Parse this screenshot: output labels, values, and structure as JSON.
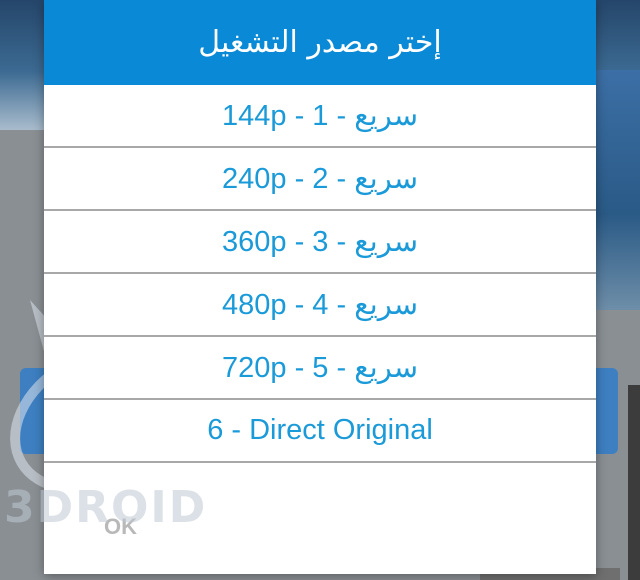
{
  "dialog": {
    "title": "إختر مصدر التشغيل",
    "options": [
      {
        "label": "سريع - 144p - 1"
      },
      {
        "label": "سريع - 240p - 2"
      },
      {
        "label": "سريع - 360p - 3"
      },
      {
        "label": "سريع - 480p - 4"
      },
      {
        "label": "سريع - 720p - 5"
      },
      {
        "label": "6 - Direct Original"
      }
    ],
    "ok_label": "OK"
  },
  "watermark": {
    "text": "3DROID"
  },
  "colors": {
    "header": "#0a8ad6",
    "option_text": "#1a9ad8",
    "divider": "#a8a8a8",
    "ok_text": "#b9b9b9"
  }
}
